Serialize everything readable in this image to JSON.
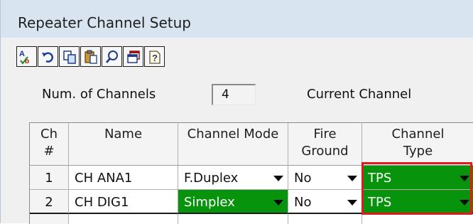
{
  "window": {
    "title": "Repeater Channel Setup"
  },
  "toolbar": {
    "buttons": [
      {
        "icon": "spell-check-icon"
      },
      {
        "icon": "undo-icon"
      },
      {
        "icon": "copy-icon"
      },
      {
        "icon": "paste-icon"
      },
      {
        "icon": "find-icon"
      },
      {
        "icon": "window-icon"
      },
      {
        "icon": "help-icon"
      }
    ]
  },
  "info": {
    "num_channels_label": "Num. of Channels",
    "num_channels_value": "4",
    "current_channel_label": "Current Channel"
  },
  "grid": {
    "headers": {
      "ch": "Ch\n#",
      "name": "Name",
      "mode": "Channel Mode",
      "fire": "Fire\nGround",
      "type": "Channel\nType"
    },
    "rows": [
      {
        "num": "1",
        "name": "CH ANA1",
        "mode": "F.Duplex",
        "fire": "No",
        "type": "TPS"
      },
      {
        "num": "2",
        "name": "CH DIG1",
        "mode": "Simplex",
        "fire": "No",
        "type": "TPS"
      }
    ]
  },
  "colors": {
    "green": "#08930c",
    "highlight": "#e3191f"
  }
}
